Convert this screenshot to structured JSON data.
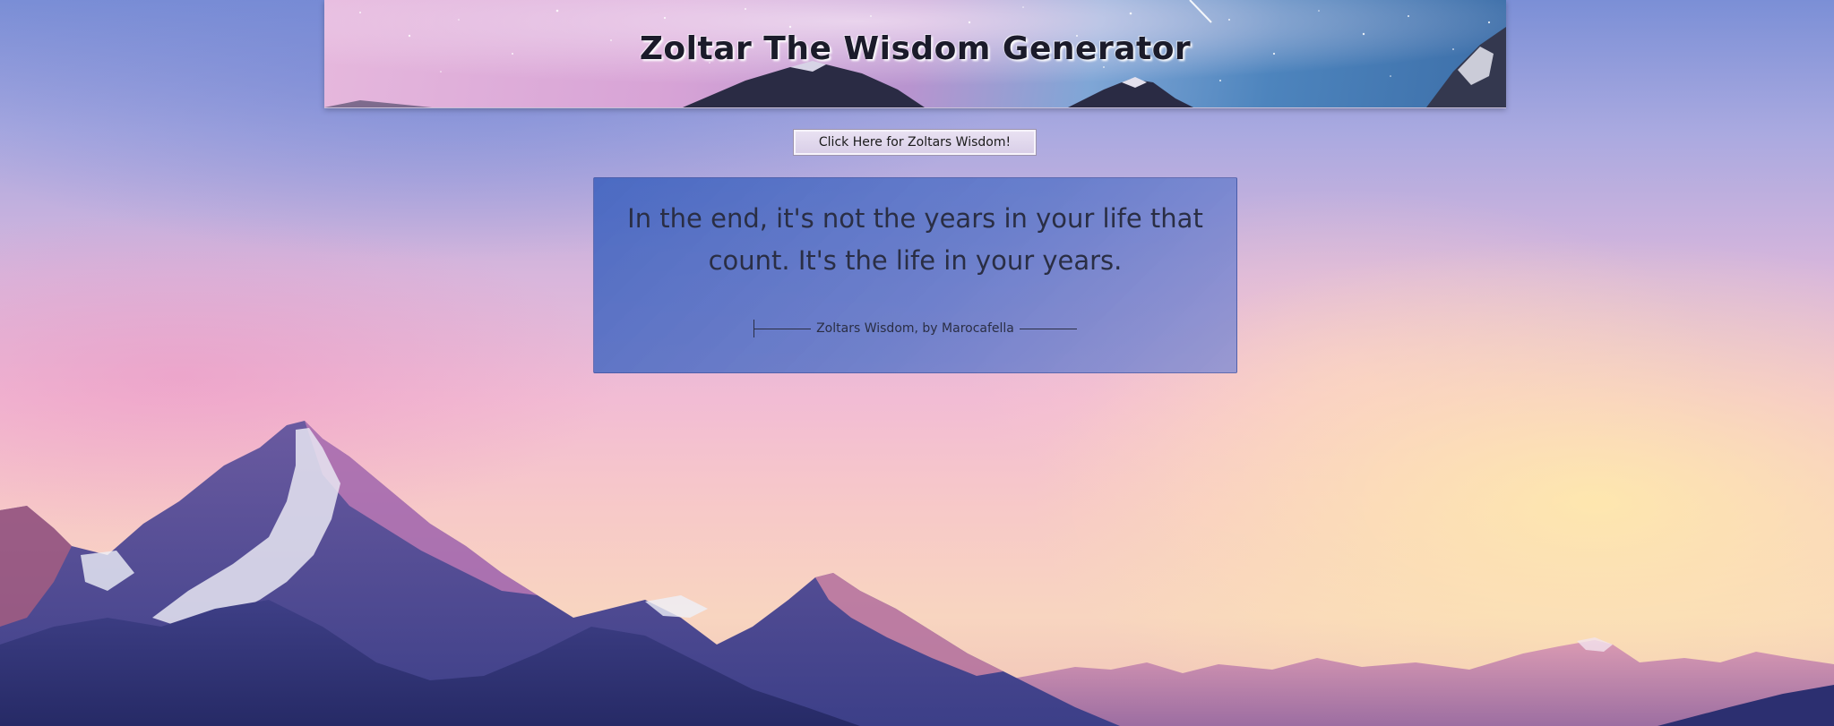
{
  "header": {
    "title": "Zoltar The Wisdom Generator"
  },
  "controls": {
    "wisdom_button_label": "Click Here for Zoltars Wisdom!"
  },
  "quote": {
    "text": "In the end, it's not the years in your life that count. It's the life in your years.",
    "attribution": "Zoltars Wisdom, by Marocafella"
  },
  "colors": {
    "card_background": "#4a6fc4",
    "text": "#2a2e44",
    "title": "#1b1b2a"
  },
  "icons": {
    "background": "mountain-landscape",
    "banner": "starry-sky-mountains"
  }
}
